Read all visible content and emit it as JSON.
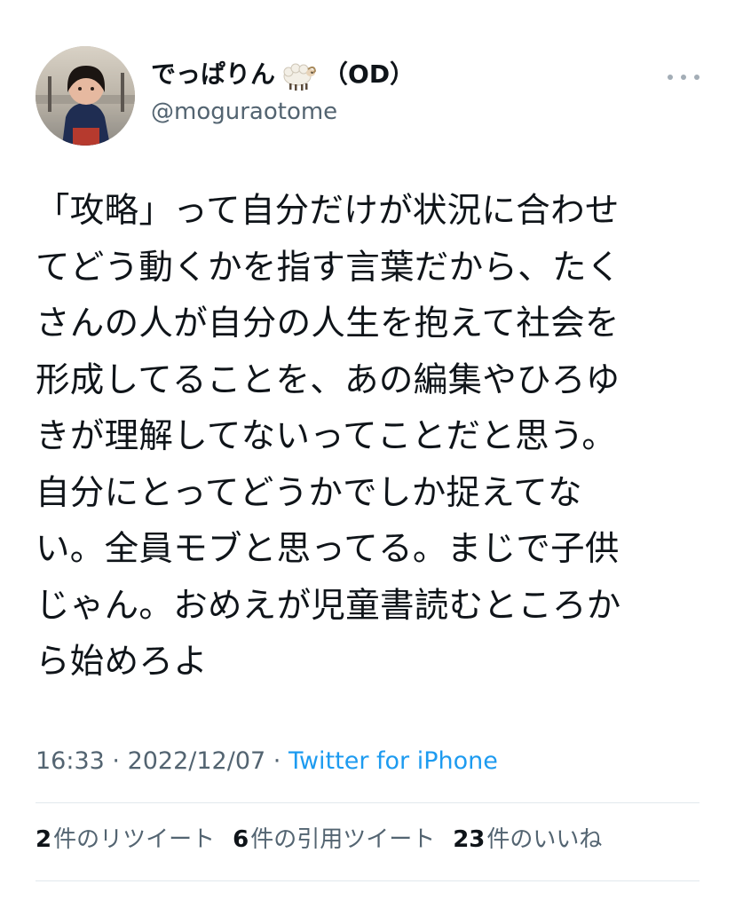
{
  "author": {
    "display_name": "でっぱりん",
    "display_name_suffix": "（OD）",
    "emoji": "sheep-emoji",
    "handle": "@moguraotome",
    "avatar": "avatar-photo-child"
  },
  "tweet": {
    "lines": [
      "「攻略」って自分だけが状況に合わせ",
      "てどう動くかを指す言葉だから、たく",
      "さんの人が自分の人生を抱えて社会を",
      "形成してることを、あの編集やひろゆ",
      "きが理解してないってことだと思う。",
      "自分にとってどうかでしか捉えてな",
      "い。全員モブと思ってる。まじで子供",
      "じゃん。おめえが児童書読むところか",
      "ら始めろよ"
    ]
  },
  "meta": {
    "time": "16:33",
    "separator": " · ",
    "date": "2022/12/07",
    "source": "Twitter for iPhone"
  },
  "stats": {
    "retweets_count": "2",
    "retweets_label": "件のリツイート",
    "quotes_count": "6",
    "quotes_label": "件の引用ツイート",
    "likes_count": "23",
    "likes_label": "件のいいね"
  },
  "colors": {
    "text": "#0f1419",
    "secondary": "#536471",
    "link": "#1d9bf0",
    "divider": "#e1e8ed"
  }
}
